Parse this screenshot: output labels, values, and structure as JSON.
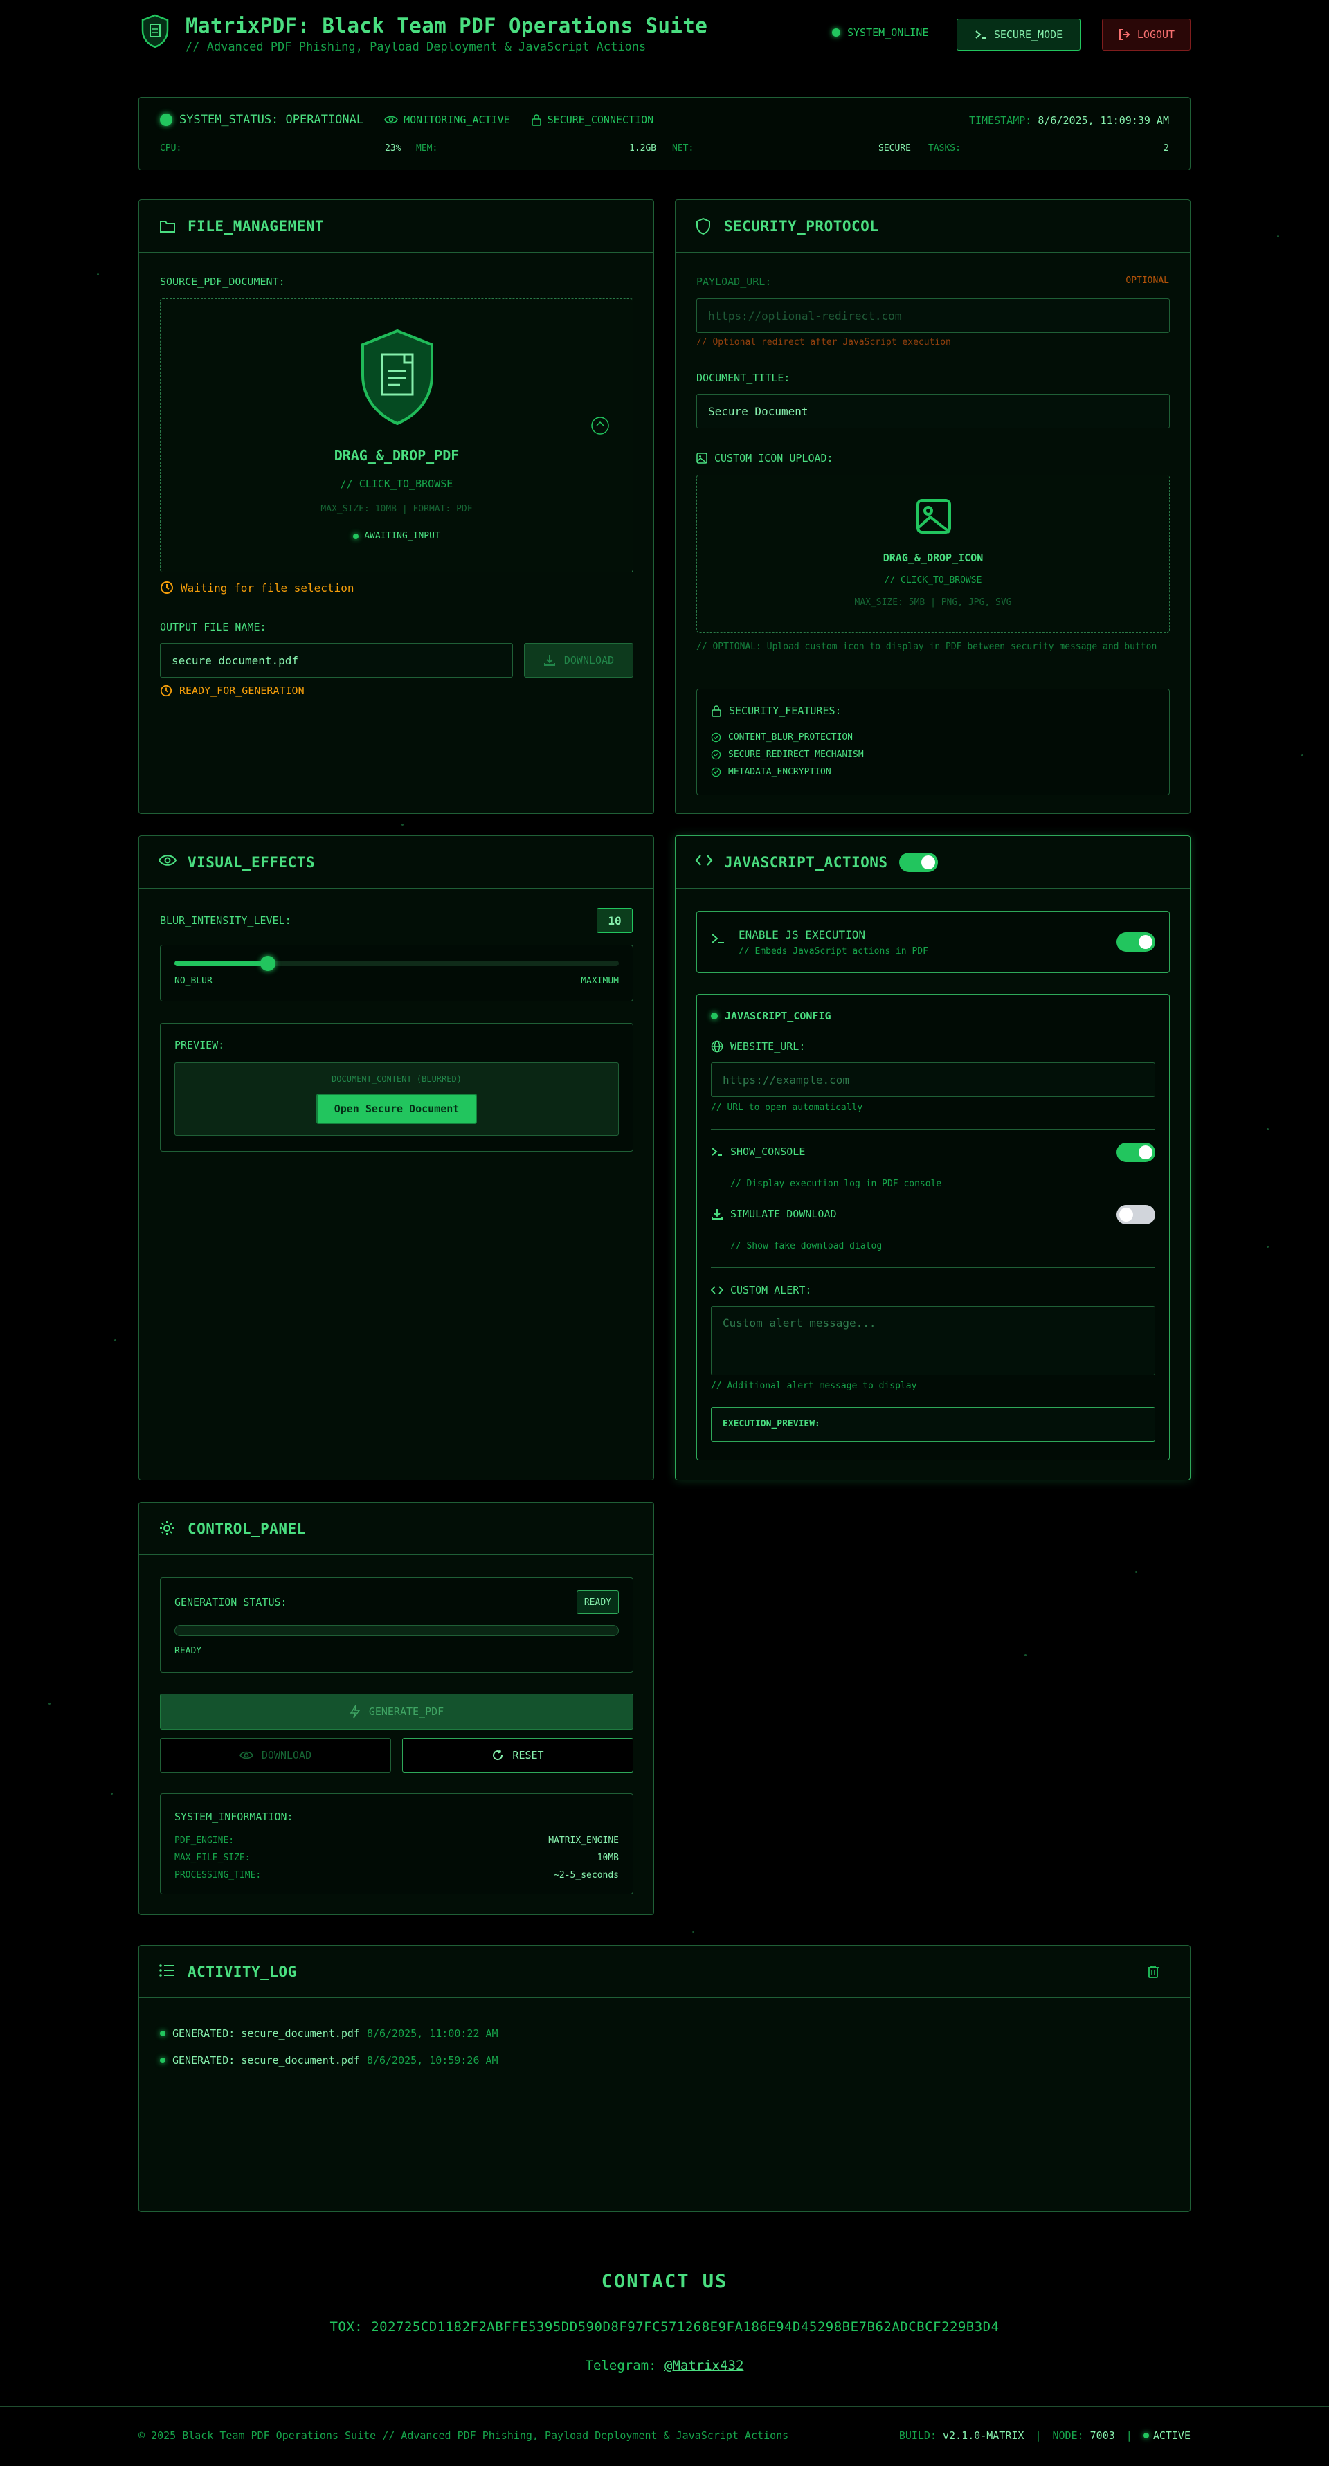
{
  "header": {
    "title": "MatrixPDF: Black Team PDF Operations Suite",
    "subtitle": "// Advanced PDF Phishing, Payload Deployment & JavaScript Actions",
    "online": "SYSTEM_ONLINE",
    "secure_mode": "SECURE_MODE",
    "logout": "LOGOUT"
  },
  "status": {
    "system": "SYSTEM_STATUS: OPERATIONAL",
    "monitoring": "MONITORING_ACTIVE",
    "connection": "SECURE_CONNECTION",
    "timestamp_label": "TIMESTAMP:",
    "timestamp": "8/6/2025, 11:09:39 AM",
    "cpu_label": "CPU:",
    "cpu": "23%",
    "mem_label": "MEM:",
    "mem": "1.2GB",
    "net_label": "NET:",
    "net": "SECURE",
    "tasks_label": "TASKS:",
    "tasks": "2"
  },
  "file_mgmt": {
    "title": "FILE_MANAGEMENT",
    "source_label": "SOURCE_PDF_DOCUMENT:",
    "drop_title": "DRAG_&_DROP_PDF",
    "drop_browse": "// CLICK_TO_BROWSE",
    "drop_limits": "MAX_SIZE: 10MB | FORMAT: PDF",
    "drop_state": "AWAITING_INPUT",
    "waiting": "Waiting for file selection",
    "output_label": "OUTPUT_FILE_NAME:",
    "output_value": "secure_document.pdf",
    "download": "DOWNLOAD",
    "ready": "READY_FOR_GENERATION"
  },
  "security": {
    "title": "SECURITY_PROTOCOL",
    "payload_label": "PAYLOAD_URL:",
    "optional": "OPTIONAL",
    "payload_placeholder": "https://optional-redirect.com",
    "payload_note": "// Optional redirect after JavaScript execution",
    "doc_title_label": "DOCUMENT_TITLE:",
    "doc_title_value": "Secure Document",
    "icon_label": "CUSTOM_ICON_UPLOAD:",
    "icon_drop": "DRAG_&_DROP_ICON",
    "icon_browse": "// CLICK_TO_BROWSE",
    "icon_limits": "MAX_SIZE: 5MB | PNG, JPG, SVG",
    "icon_note": "// OPTIONAL: Upload custom icon to display in PDF between security message and button",
    "features_title": "SECURITY_FEATURES:",
    "features": [
      "CONTENT_BLUR_PROTECTION",
      "SECURE_REDIRECT_MECHANISM",
      "METADATA_ENCRYPTION"
    ]
  },
  "visual": {
    "title": "VISUAL_EFFECTS",
    "blur_label": "BLUR_INTENSITY_LEVEL:",
    "blur_value": "10",
    "blur_fraction": 0.21,
    "min_label": "NO_BLUR",
    "max_label": "MAXIMUM",
    "preview_label": "PREVIEW:",
    "preview_content": "DOCUMENT_CONTENT (BLURRED)",
    "preview_button": "Open Secure Document"
  },
  "js": {
    "title": "JAVASCRIPT_ACTIONS",
    "enable_label": "ENABLE_JS_EXECUTION",
    "enable_note": "// Embeds JavaScript actions in PDF",
    "config_title": "JAVASCRIPT_CONFIG",
    "website_label": "WEBSITE_URL:",
    "website_placeholder": "https://example.com",
    "website_note": "// URL to open automatically",
    "console_label": "SHOW_CONSOLE",
    "console_note": "// Display execution log in PDF console",
    "download_label": "SIMULATE_DOWNLOAD",
    "download_note": "// Show fake download dialog",
    "alert_label": "CUSTOM_ALERT:",
    "alert_placeholder": "Custom alert message...",
    "alert_note": "// Additional alert message to display",
    "preview_label": "EXECUTION_PREVIEW:"
  },
  "control": {
    "title": "CONTROL_PANEL",
    "gen_status_label": "GENERATION_STATUS:",
    "badge": "READY",
    "progress": 0,
    "state": "READY",
    "generate": "GENERATE_PDF",
    "download": "DOWNLOAD",
    "reset": "RESET",
    "sysinfo_title": "SYSTEM_INFORMATION:",
    "engine_label": "PDF_ENGINE:",
    "engine": "MATRIX_ENGINE",
    "maxsize_label": "MAX_FILE_SIZE:",
    "maxsize": "10MB",
    "time_label": "PROCESSING_TIME:",
    "time": "~2-5_seconds"
  },
  "activity": {
    "title": "ACTIVITY_LOG",
    "entries": [
      {
        "text": "GENERATED: secure_document.pdf",
        "time": "8/6/2025, 11:00:22 AM"
      },
      {
        "text": "GENERATED: secure_document.pdf",
        "time": "8/6/2025, 10:59:26 AM"
      }
    ]
  },
  "contact": {
    "title": "CONTACT US",
    "tox": "TOX: 202725CD1182F2ABFFE5395DD590D8F97FC571268E9FA186E94D45298BE7B62ADCBCF229B3D4",
    "telegram_label": "Telegram:",
    "telegram_handle": "@Matrix432"
  },
  "footer": {
    "copyright": "© 2025 Black Team PDF Operations Suite // Advanced PDF Phishing, Payload Deployment & JavaScript Actions",
    "build_label": "BUILD:",
    "build": "v2.1.0-MATRIX",
    "node_label": "NODE:",
    "node": "7003",
    "active": "ACTIVE"
  },
  "colors": {
    "accent": "#22c55e",
    "warning": "#f59e0b",
    "danger": "#f87171",
    "background": "#000000"
  }
}
